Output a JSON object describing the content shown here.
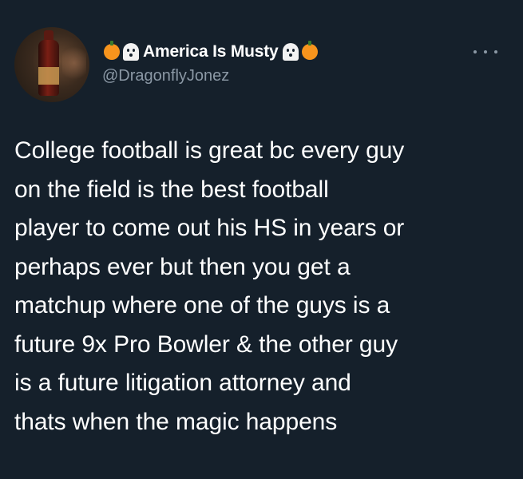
{
  "author": {
    "display_name": "America Is Musty",
    "handle": "@DragonflyJonez",
    "name_decorations": [
      "pumpkin-icon",
      "ghost-icon",
      "ghost-icon",
      "pumpkin-icon"
    ]
  },
  "menu": {
    "icon": "more-options-icon"
  },
  "tweet": {
    "lines": [
      "College football is great bc every guy",
      "on the field is the best football",
      "player to come out his HS in years or",
      "perhaps ever but then you get a",
      "matchup where one of the guys is a",
      "future 9x Pro Bowler & the other guy",
      "is a future litigation attorney and",
      "thats when the magic happens"
    ]
  },
  "colors": {
    "background": "#15202b",
    "text_primary": "#ffffff",
    "text_secondary": "#8b98a5",
    "pumpkin": "#f7941d"
  }
}
